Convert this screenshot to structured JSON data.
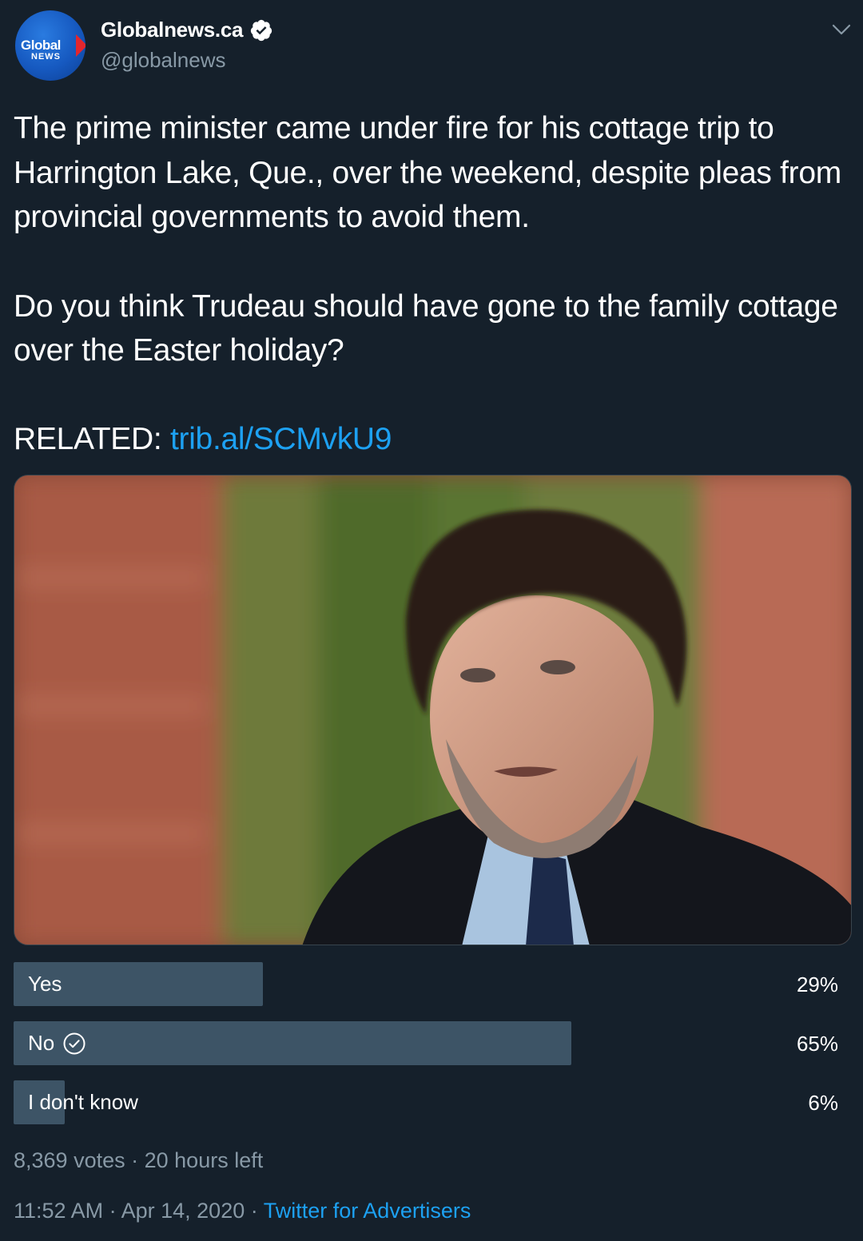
{
  "author": {
    "display_name": "Globalnews.ca",
    "handle": "@globalnews",
    "logo_text": "Global",
    "logo_subtext": "NEWS",
    "verified": true
  },
  "tweet": {
    "paragraph1": "The prime minister came under fire for his cottage trip to Harrington Lake, Que., over the weekend, despite pleas from provincial governments to avoid them.",
    "paragraph2": "Do you think Trudeau should have gone to the family cottage over the Easter holiday?",
    "related_label": "RELATED: ",
    "related_link": "trib.al/SCMvkU9"
  },
  "poll": {
    "options": [
      {
        "label": "Yes",
        "percent_text": "29%",
        "percent": 29,
        "selected": false
      },
      {
        "label": "No",
        "percent_text": "65%",
        "percent": 65,
        "selected": true
      },
      {
        "label": "I don't know",
        "percent_text": "6%",
        "percent": 6,
        "selected": false
      }
    ],
    "votes": "8,369 votes",
    "time_left": "20 hours left"
  },
  "timestamp": {
    "time": "11:52 AM",
    "date": "Apr 14, 2020",
    "source": "Twitter for Advertisers"
  },
  "colors": {
    "background": "#15202b",
    "link": "#1da1f2",
    "muted": "#8899a6",
    "poll_bar": "#3d5466"
  },
  "icons": [
    "verified-badge-icon",
    "chevron-down-icon",
    "check-circle-icon"
  ]
}
